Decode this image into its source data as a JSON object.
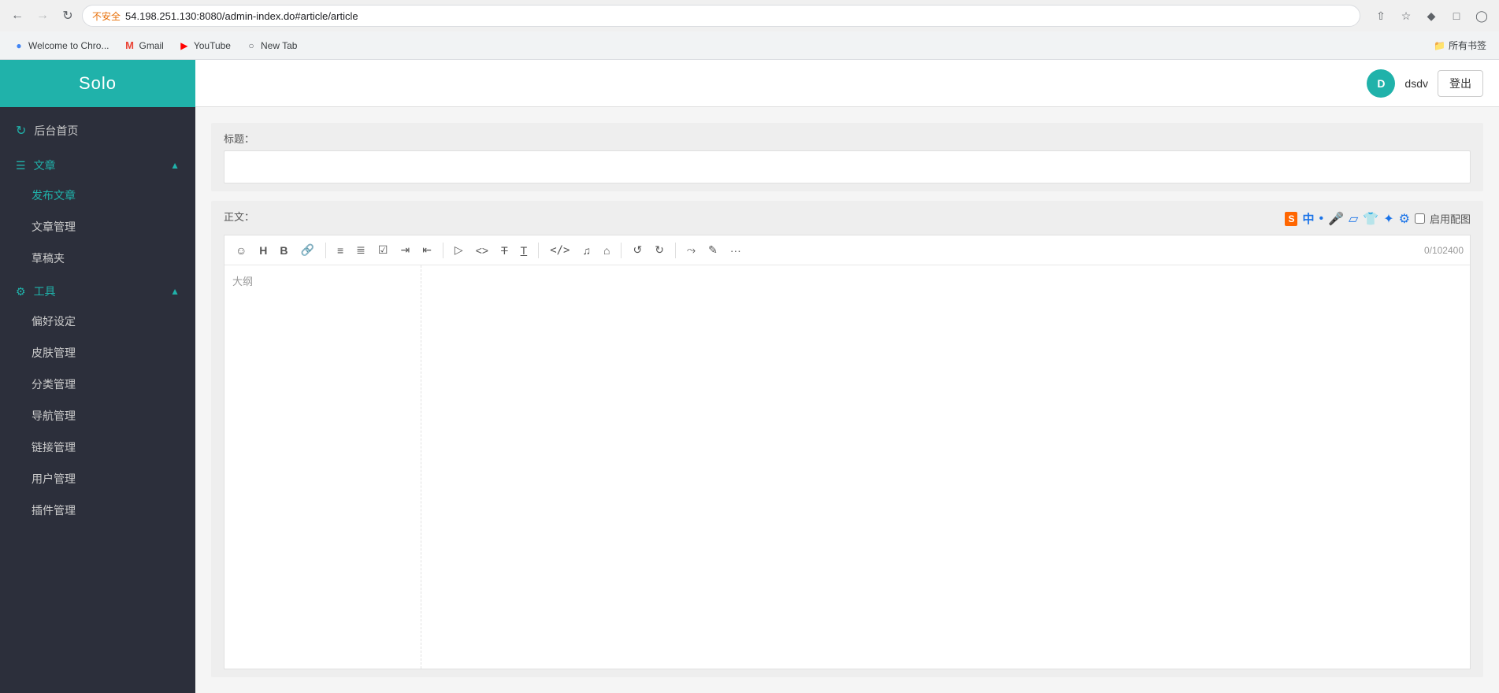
{
  "browser": {
    "url": "54.198.251.130:8080/admin-index.do#article/article",
    "warning_text": "不安全",
    "back_disabled": false,
    "forward_disabled": true
  },
  "bookmarks": {
    "items": [
      {
        "id": "welcome",
        "label": "Welcome to Chro...",
        "icon": "chrome"
      },
      {
        "id": "gmail",
        "label": "Gmail",
        "icon": "gmail"
      },
      {
        "id": "youtube",
        "label": "YouTube",
        "icon": "youtube"
      },
      {
        "id": "newtab",
        "label": "New Tab",
        "icon": "globe"
      }
    ],
    "folder_label": "所有书签"
  },
  "sidebar": {
    "title": "Solo",
    "nav_items": [
      {
        "id": "dashboard",
        "label": "后台首页",
        "icon": "refresh"
      }
    ],
    "sections": [
      {
        "id": "article",
        "label": "文章",
        "icon": "list",
        "expanded": true,
        "sub_items": [
          {
            "id": "publish",
            "label": "发布文章",
            "active": true
          },
          {
            "id": "manage",
            "label": "文章管理",
            "active": false
          },
          {
            "id": "drafts",
            "label": "草稿夹",
            "active": false
          }
        ]
      },
      {
        "id": "tools",
        "label": "工具",
        "icon": "gear",
        "expanded": true,
        "sub_items": [
          {
            "id": "preferences",
            "label": "偏好设定",
            "active": false
          },
          {
            "id": "skins",
            "label": "皮肤管理",
            "active": false
          },
          {
            "id": "categories",
            "label": "分类管理",
            "active": false
          },
          {
            "id": "navigation",
            "label": "导航管理",
            "active": false
          },
          {
            "id": "links",
            "label": "链接管理",
            "active": false
          },
          {
            "id": "users",
            "label": "用户管理",
            "active": false
          },
          {
            "id": "plugins",
            "label": "插件管理",
            "active": false
          }
        ]
      }
    ]
  },
  "header": {
    "user_name": "dsdv",
    "user_initials": "D",
    "logout_label": "登出"
  },
  "editor": {
    "title_label": "标题：",
    "title_placeholder": "",
    "content_label": "正文：",
    "enable_config_label": "启用配图",
    "outline_placeholder": "大纲",
    "char_count": "0/102400",
    "toolbar_buttons": [
      {
        "id": "emoji",
        "icon": "☺",
        "title": "emoji"
      },
      {
        "id": "heading",
        "icon": "H",
        "title": "heading"
      },
      {
        "id": "bold",
        "icon": "B",
        "title": "bold"
      },
      {
        "id": "link",
        "icon": "🔗",
        "title": "link"
      },
      {
        "id": "sep1",
        "type": "separator"
      },
      {
        "id": "ul",
        "icon": "≡",
        "title": "unordered list"
      },
      {
        "id": "ol",
        "icon": "≣",
        "title": "ordered list"
      },
      {
        "id": "check",
        "icon": "☑",
        "title": "checklist"
      },
      {
        "id": "indent",
        "icon": "⇥",
        "title": "indent"
      },
      {
        "id": "outdent",
        "icon": "⇤",
        "title": "outdent"
      },
      {
        "id": "sep2",
        "type": "separator"
      },
      {
        "id": "play",
        "icon": "▷",
        "title": "preview"
      },
      {
        "id": "code",
        "icon": "◇",
        "title": "code"
      },
      {
        "id": "strike",
        "icon": "T̶",
        "title": "strikethrough"
      },
      {
        "id": "underline",
        "icon": "T̲",
        "title": "underline"
      },
      {
        "id": "sep3",
        "type": "separator"
      },
      {
        "id": "inline-code",
        "icon": "<>",
        "title": "inline code"
      },
      {
        "id": "mic",
        "icon": "♪",
        "title": "audio"
      },
      {
        "id": "table",
        "icon": "⊞",
        "title": "table"
      },
      {
        "id": "sep4",
        "type": "separator"
      },
      {
        "id": "undo",
        "icon": "↺",
        "title": "undo"
      },
      {
        "id": "redo",
        "icon": "↻",
        "title": "redo"
      },
      {
        "id": "sep5",
        "type": "separator"
      },
      {
        "id": "fullscreen",
        "icon": "⤢",
        "title": "fullscreen"
      },
      {
        "id": "edit",
        "icon": "✎",
        "title": "edit"
      },
      {
        "id": "more",
        "icon": "···",
        "title": "more"
      }
    ],
    "sogou_tools": [
      {
        "id": "sogou",
        "label": "S",
        "title": "Sogou"
      },
      {
        "id": "zhong",
        "label": "中",
        "title": "Chinese"
      },
      {
        "id": "dot",
        "label": "•",
        "title": "dot"
      },
      {
        "id": "mic2",
        "label": "🎤",
        "title": "mic"
      },
      {
        "id": "table2",
        "label": "▦",
        "title": "table"
      },
      {
        "id": "shirt",
        "label": "👕",
        "title": "shirt"
      },
      {
        "id": "grid",
        "label": "⊞",
        "title": "grid"
      },
      {
        "id": "settings",
        "label": "⚙",
        "title": "settings"
      }
    ]
  }
}
